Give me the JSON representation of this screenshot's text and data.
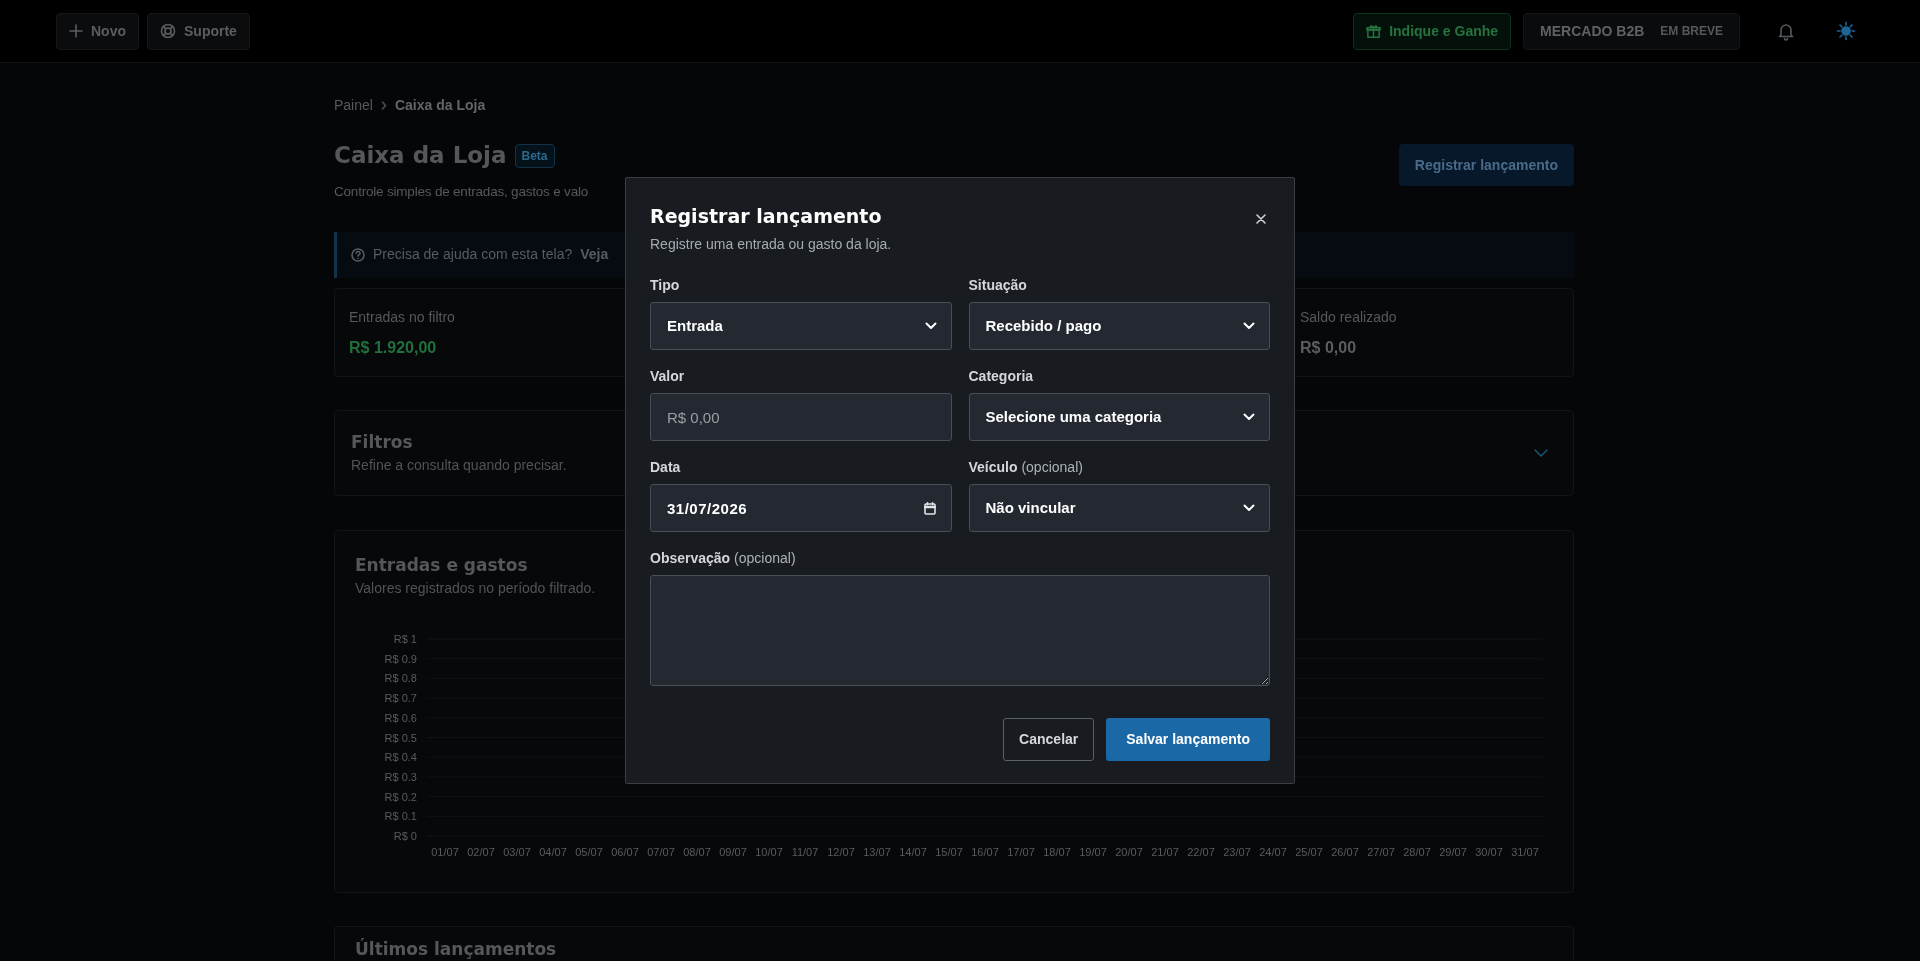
{
  "topbar": {
    "left_buttons": [
      {
        "label": "Novo"
      },
      {
        "label": "Suporte"
      }
    ],
    "referral_button": {
      "label": "Indique e Ganhe"
    },
    "market_button": {
      "label": "MERCADO B2B",
      "badge": "EM BREVE"
    }
  },
  "breadcrumb": [
    {
      "label": "Painel",
      "current": false
    },
    {
      "label": "Caixa da Loja",
      "current": true
    }
  ],
  "page": {
    "title": "Caixa da Loja",
    "badge": "Beta",
    "subtitle": "Controle simples de entradas, gastos e valo",
    "action": "Registrar lançamento"
  },
  "help_alert": {
    "text": "Precisa de ajuda com esta tela?",
    "link": "Veja"
  },
  "summary_cards": [
    {
      "label": "Entradas no filtro",
      "value": "R$ 1.920,00",
      "color": "#21703d"
    },
    {
      "label": "Saldo realizado",
      "value": "R$ 0,00",
      "color": "#5a5e62"
    }
  ],
  "filters": {
    "title": "Filtros",
    "subtitle": "Refine a consulta quando precisar.",
    "expanded": false
  },
  "chart_card": {
    "title": "Entradas e gastos",
    "subtitle": "Valores registrados no período filtrado.",
    "y_axis_labels": [
      "R$ 1",
      "R$ 0.9",
      "R$ 0.8",
      "R$ 0.7",
      "R$ 0.6",
      "R$ 0.5",
      "R$ 0.4",
      "R$ 0.3",
      "R$ 0.2",
      "R$ 0.1",
      "R$ 0"
    ],
    "x_axis_labels": [
      "01/07",
      "02/07",
      "03/07",
      "04/07",
      "05/07",
      "06/07",
      "07/07",
      "08/07",
      "09/07",
      "10/07",
      "11/07",
      "12/07",
      "13/07",
      "14/07",
      "15/07",
      "16/07",
      "17/07",
      "18/07",
      "19/07",
      "20/07",
      "21/07",
      "22/07",
      "23/07",
      "24/07",
      "25/07",
      "26/07",
      "27/07",
      "28/07",
      "29/07",
      "30/07",
      "31/07"
    ]
  },
  "recent": {
    "title": "Últimos lançamentos"
  },
  "modal": {
    "title": "Registrar lançamento",
    "subtitle": "Registre uma entrada ou gasto da loja.",
    "fields": [
      {
        "kind": "select",
        "label": "Tipo",
        "value": "Entrada"
      },
      {
        "kind": "select",
        "label": "Situação",
        "value": "Recebido / pago"
      },
      {
        "kind": "input",
        "label": "Valor",
        "placeholder": "R$ 0,00"
      },
      {
        "kind": "select",
        "label": "Categoria",
        "value": "Selecione uma categoria"
      },
      {
        "kind": "date",
        "label": "Data",
        "value": "31/07/2026"
      },
      {
        "kind": "select",
        "label": "Veículo",
        "hint": "(opcional)",
        "value": "Não vincular"
      },
      {
        "kind": "textarea",
        "label": "Observação",
        "hint": "(opcional)"
      }
    ],
    "buttons": [
      {
        "label": "Cancelar",
        "kind": "secondary"
      },
      {
        "label": "Salvar lançamento",
        "kind": "primary"
      }
    ]
  }
}
